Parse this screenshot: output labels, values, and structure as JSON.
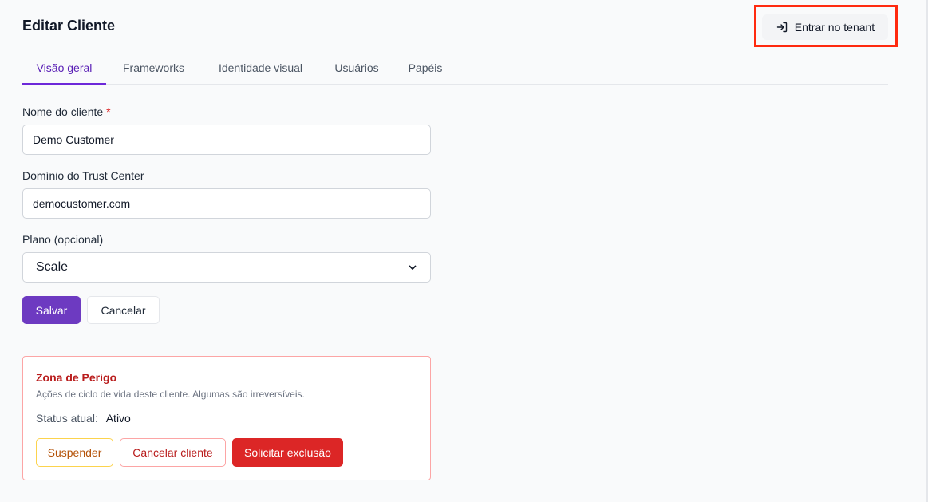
{
  "header": {
    "title": "Editar Cliente",
    "enter_tenant_label": "Entrar no tenant"
  },
  "tabs": [
    {
      "label": "Visão geral",
      "active": true
    },
    {
      "label": "Frameworks",
      "active": false
    },
    {
      "label": "Identidade visual",
      "active": false
    },
    {
      "label": "Usuários",
      "active": false
    },
    {
      "label": "Papéis",
      "active": false
    }
  ],
  "form": {
    "name_label": "Nome do cliente",
    "required_marker": "*",
    "name_value": "Demo Customer",
    "domain_label": "Domínio do Trust Center",
    "domain_value": "democustomer.com",
    "plan_label": "Plano (opcional)",
    "plan_value": "Scale",
    "save_label": "Salvar",
    "cancel_label": "Cancelar"
  },
  "danger_zone": {
    "title": "Zona de Perigo",
    "description": "Ações de ciclo de vida deste cliente. Algumas são irreversíveis.",
    "status_label": "Status atual:",
    "status_value": "Ativo",
    "suspend_label": "Suspender",
    "cancel_client_label": "Cancelar cliente",
    "delete_label": "Solicitar exclusão"
  },
  "colors": {
    "accent": "#6d3ac1",
    "danger": "#dc2626",
    "highlight": "#ff2a0f"
  },
  "icons": {
    "enter": "login-arrow-icon",
    "select": "chevron-down-icon"
  }
}
